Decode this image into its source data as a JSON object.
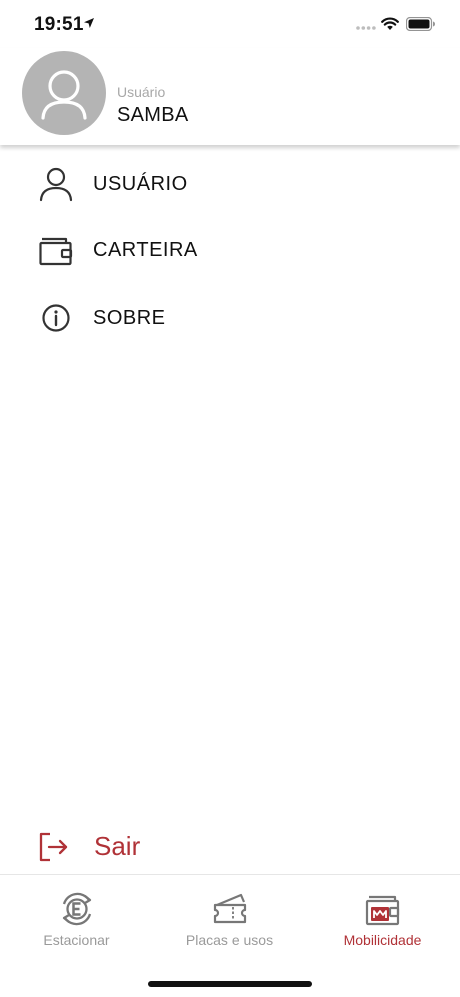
{
  "status": {
    "time": "19:51"
  },
  "profile": {
    "caption": "Usuário",
    "name": "SAMBA"
  },
  "menu": [
    {
      "label": "USUÁRIO",
      "icon": "user-icon"
    },
    {
      "label": "CARTEIRA",
      "icon": "wallet-icon"
    },
    {
      "label": "SOBRE",
      "icon": "info-icon"
    }
  ],
  "logout": {
    "label": "Sair",
    "icon": "logout-icon"
  },
  "tabs": [
    {
      "label": "Estacionar",
      "icon": "parking-sync-icon",
      "active": false
    },
    {
      "label": "Placas e usos",
      "icon": "ticket-icon",
      "active": false
    },
    {
      "label": "Mobilicidade",
      "icon": "mobilicidade-wallet-icon",
      "active": true
    }
  ],
  "colors": {
    "accent": "#b03237",
    "inactive": "#9a9a9a",
    "avatar_bg": "#b4b4b4"
  }
}
